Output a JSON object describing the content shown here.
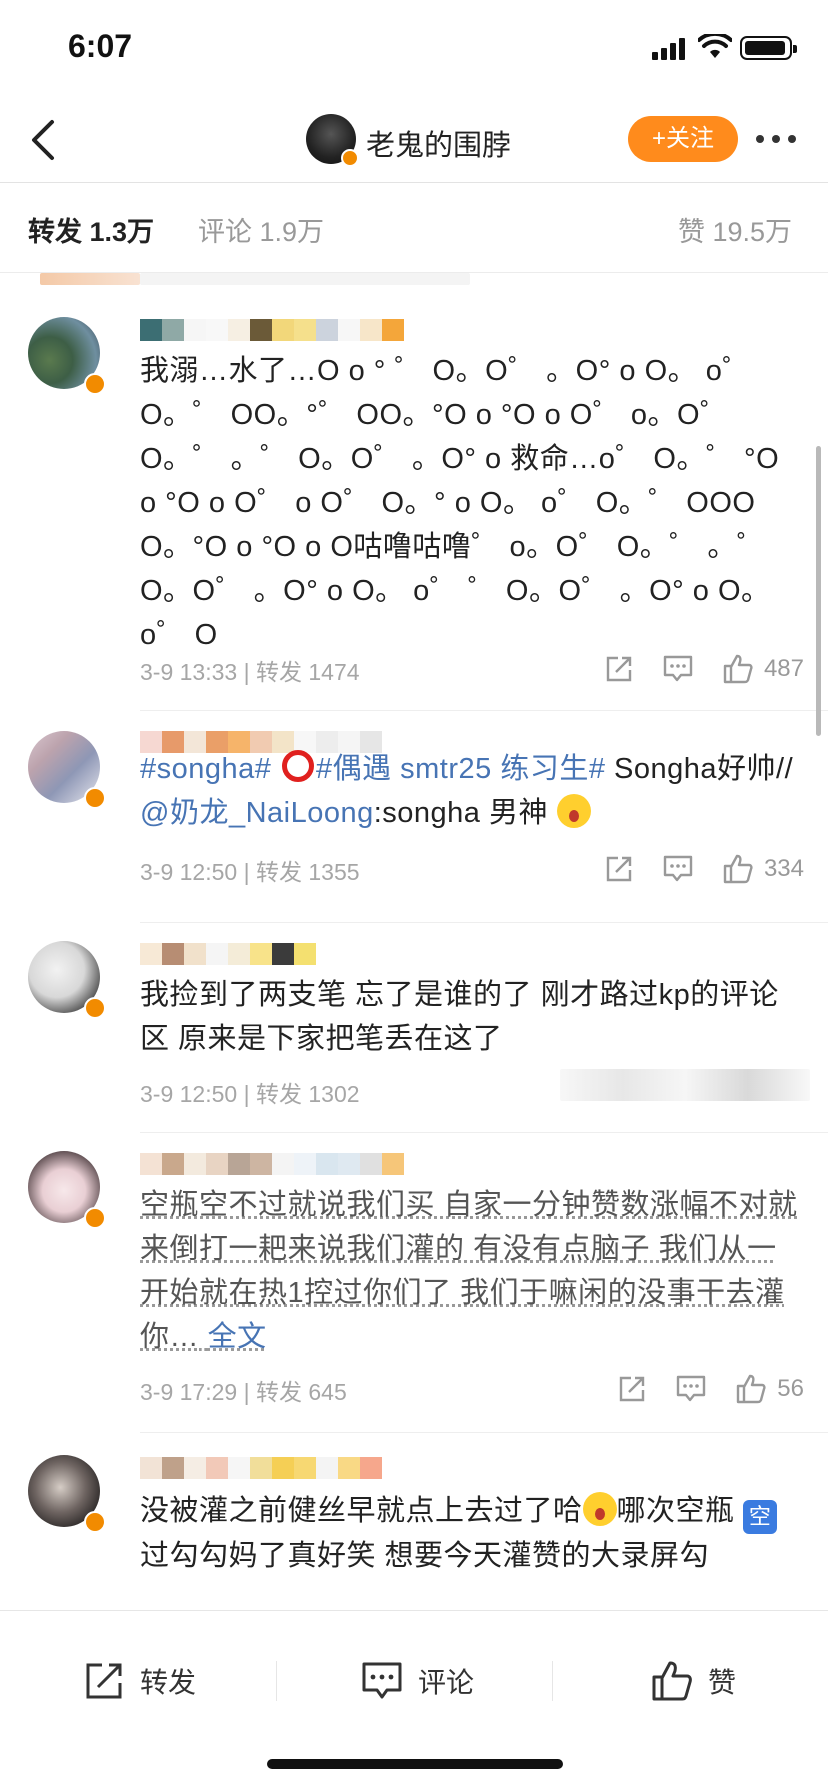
{
  "status_bar": {
    "time": "6:07"
  },
  "header": {
    "title": "老鬼的围脖",
    "follow_label": "+关注",
    "more_icon": "more-dots-icon"
  },
  "tabs": {
    "repost": "转发 1.3万",
    "comment": "评论 1.9万",
    "like": "赞 19.5万"
  },
  "reposts": [
    {
      "text": "我溺…水了…O o ° ゜ O。O゜ 。O° o O。 o゜ O。゜ OO。°゜ OO。°O o °O o O゜ o。O゜ O。゜ 。゜ O。O゜ 。O° o 救命…o゜ O。゜ °O o °O o O゜ o O゜ O。° o O。 o゜ O。゜ OOO O。°O o °O o O咕噜咕噜゜ o。O゜ O。゜ 。゜ O。O゜ 。O° o O。 o゜ ゜ O。O゜ 。O° o O。 o゜ O",
      "time": "3-9 13:33",
      "repost_count": "转发 1474",
      "likes": "487"
    },
    {
      "tag1": "#songha#",
      "tag2": "#偶遇 smtr25 练习生#",
      "text_after": " Songha好帅//",
      "mention": "@奶龙_NaiLoong",
      "text_end": ":songha 男神",
      "time": "3-9 12:50",
      "repost_count": "转发 1355",
      "likes": "334"
    },
    {
      "text": "我捡到了两支笔 忘了是谁的了 刚才路过kp的评论区 原来是下家把笔丢在这了",
      "time": "3-9 12:50",
      "repost_count": "转发 1302"
    },
    {
      "text": "空瓶空不过就说我们买 自家一分钟赞数涨幅不对就来倒打一耙来说我们灌的 有没有点脑子 我们从一开始就在热1控过你们了 我们于嘛闲的没事干去灌你…",
      "full_label": "全文",
      "time": "3-9 17:29",
      "repost_count": "转发 645",
      "likes": "56"
    },
    {
      "text_a": "没被灌之前健丝早就点上去过了哈",
      "text_b": "哪次空瓶",
      "box_emoji": "空",
      "text_c": "过勾勾妈了真好笑 想要今天灌赞的大录屏勾"
    }
  ],
  "bottom_bar": {
    "repost": "转发",
    "comment": "评论",
    "like": "赞"
  }
}
